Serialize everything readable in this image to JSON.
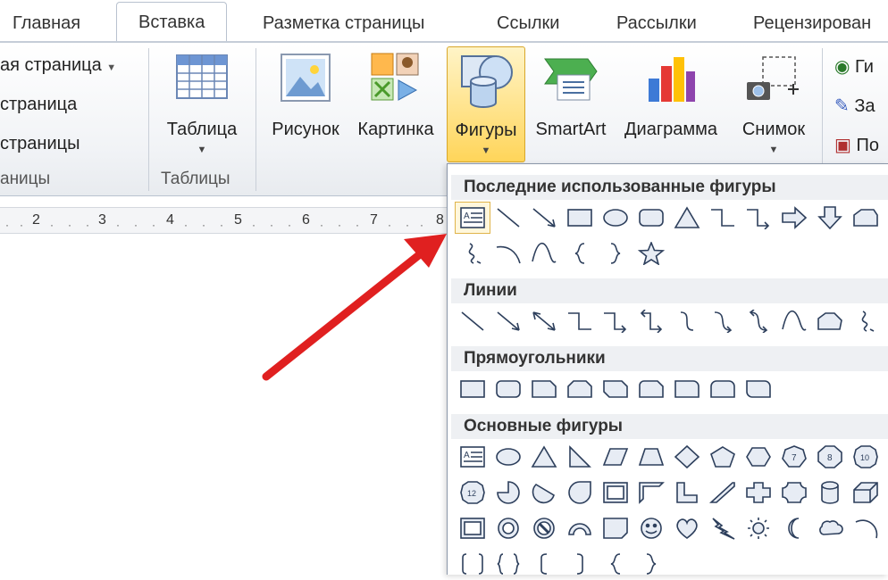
{
  "tabs": [
    "Главная",
    "Вставка",
    "Разметка страницы",
    "Ссылки",
    "Рассылки",
    "Рецензирован"
  ],
  "pages_group": {
    "items": [
      "ая страница",
      "страница",
      "страницы"
    ],
    "label": "аницы"
  },
  "tables_group": {
    "button": "Таблица",
    "label": "Таблицы"
  },
  "illustrations": [
    "Рисунок",
    "Картинка",
    "Фигуры",
    "SmartArt",
    "Диаграмма",
    "Снимок"
  ],
  "right_items": [
    "Ги",
    "За",
    "По"
  ],
  "ruler": [
    "2",
    "3",
    "4",
    "5",
    "6",
    "7",
    "8"
  ],
  "gallery": {
    "recent_title": "Последние использованные фигуры",
    "lines_title": "Линии",
    "rect_title": "Прямоугольники",
    "basic_title": "Основные фигуры"
  },
  "colors": {
    "arrow": "#e02020",
    "highlight": "#ffd55a",
    "shape_stroke": "#2d3f5c"
  }
}
